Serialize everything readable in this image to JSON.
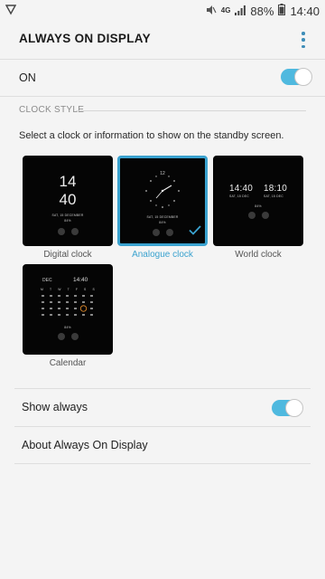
{
  "status_bar": {
    "network": "4G",
    "battery": "88%",
    "time": "14:40"
  },
  "header": {
    "title": "ALWAYS ON DISPLAY"
  },
  "master_switch": {
    "label": "ON",
    "on": true
  },
  "clock_style": {
    "section_title": "CLOCK STYLE",
    "description": "Select a clock or information to show on the standby screen.",
    "options": [
      {
        "label": "Digital clock",
        "selected": false,
        "preview": {
          "hour": "14",
          "minute": "40",
          "date": "SAT, 15 DECEMBER",
          "battery": "84%"
        }
      },
      {
        "label": "Analogue clock",
        "selected": true,
        "preview": {
          "number": "12",
          "date": "SAT, 15 DECEMBER",
          "battery": "84%"
        }
      },
      {
        "label": "World clock",
        "selected": false,
        "preview": {
          "time_a": "14:40",
          "time_b": "18:10",
          "date_a": "SAT, 15 DEC",
          "date_b": "SAT, 15 DEC",
          "battery": "84%"
        }
      },
      {
        "label": "Calendar",
        "selected": false,
        "preview": {
          "month": "DEC",
          "time": "14:40",
          "weekdays": [
            "M",
            "T",
            "W",
            "T",
            "F",
            "S",
            "S"
          ],
          "battery": "84%"
        }
      }
    ]
  },
  "settings": {
    "show_always": {
      "label": "Show always",
      "on": true
    },
    "about": {
      "label": "About Always On Display"
    }
  },
  "colors": {
    "accent": "#3aa2cf",
    "toggle_track": "#4fb9df",
    "background": "#f4f4f4"
  }
}
